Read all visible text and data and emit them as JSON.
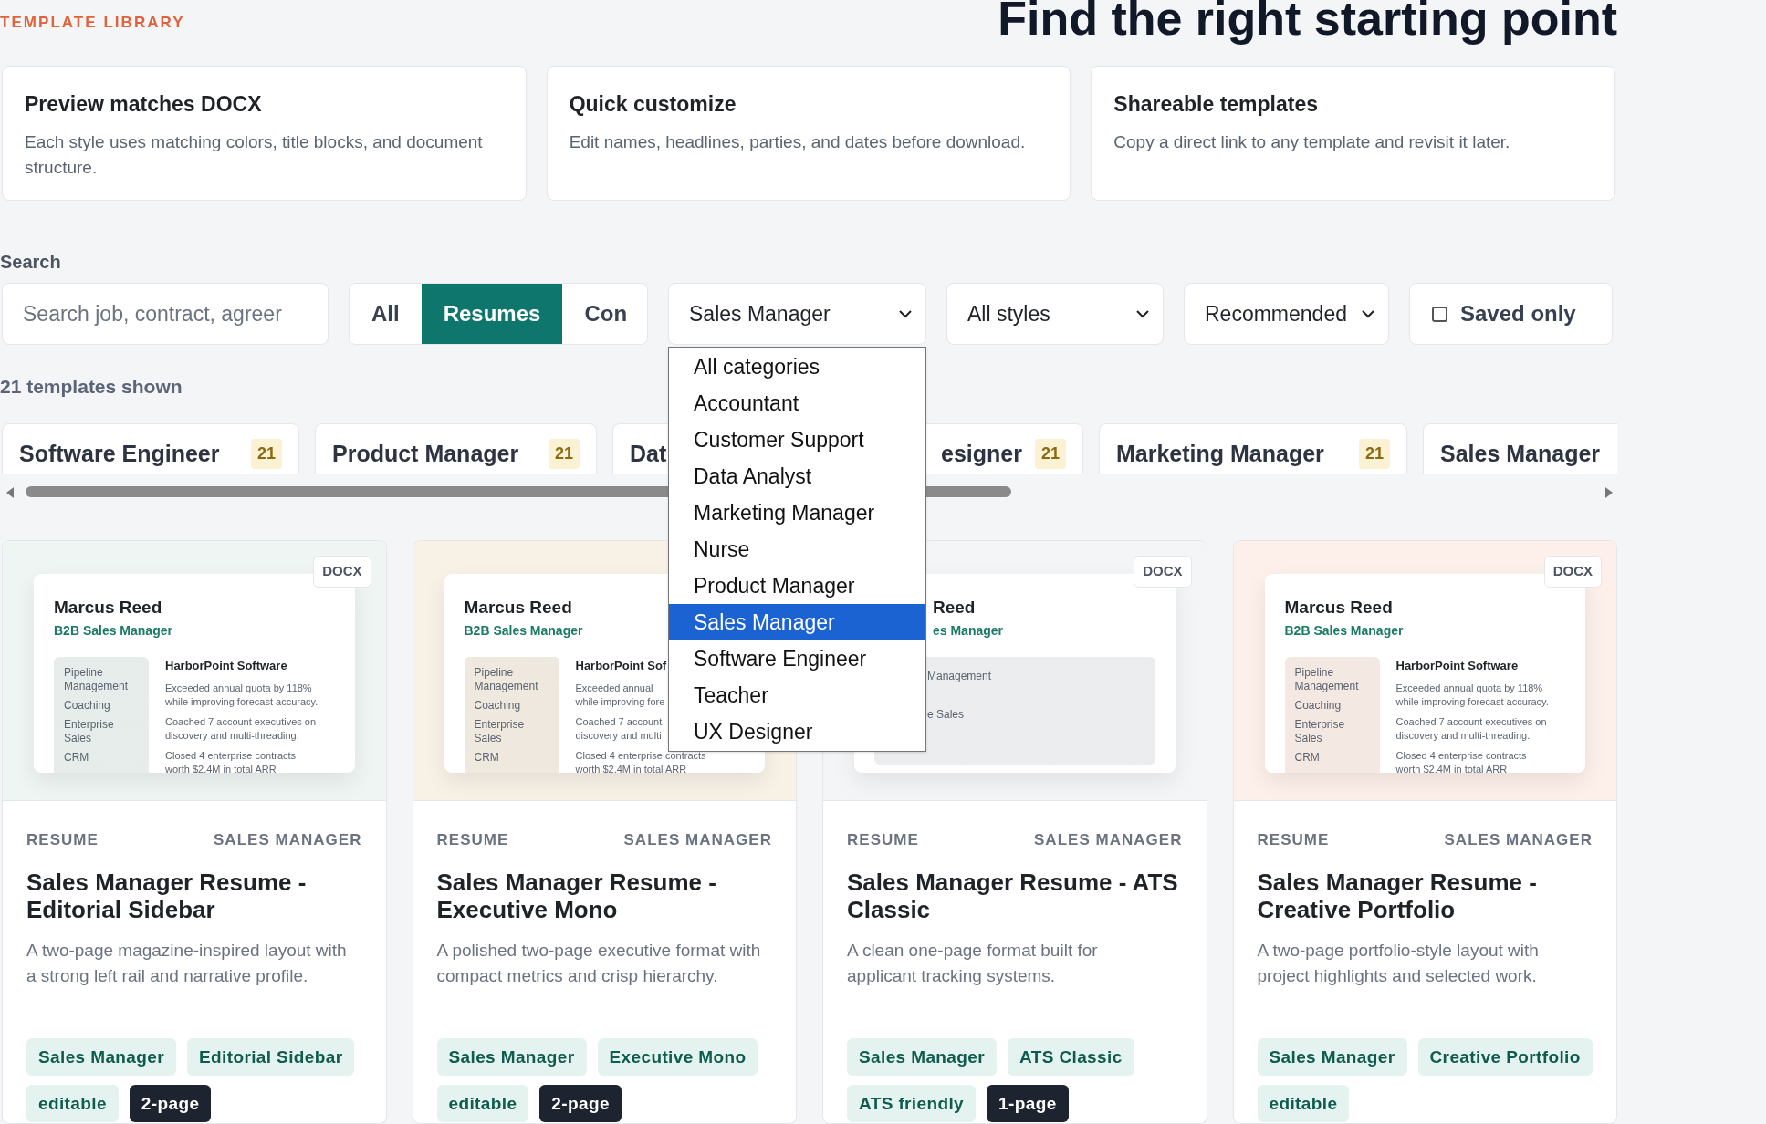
{
  "header": {
    "eyebrow": "TEMPLATE LIBRARY",
    "title": "Find the right starting point"
  },
  "features": [
    {
      "title": "Preview matches DOCX",
      "description": "Each style uses matching colors, title blocks, and document structure."
    },
    {
      "title": "Quick customize",
      "description": "Edit names, headlines, parties, and dates before download."
    },
    {
      "title": "Shareable templates",
      "description": "Copy a direct link to any template and revisit it later."
    }
  ],
  "search": {
    "label": "Search",
    "placeholder": "Search job, contract, agreer"
  },
  "type_tabs": [
    {
      "label": "All",
      "selected": false
    },
    {
      "label": "Resumes",
      "selected": true
    },
    {
      "label": "Con",
      "selected": false
    }
  ],
  "filters": [
    {
      "kind": "select",
      "value": "Sales Manager",
      "options": [
        {
          "label": "All categories",
          "selected": false
        },
        {
          "label": "Accountant",
          "selected": false
        },
        {
          "label": "Customer Support",
          "selected": false
        },
        {
          "label": "Data Analyst",
          "selected": false
        },
        {
          "label": "Marketing Manager",
          "selected": false
        },
        {
          "label": "Nurse",
          "selected": false
        },
        {
          "label": "Product Manager",
          "selected": false
        },
        {
          "label": "Sales Manager",
          "selected": true
        },
        {
          "label": "Software Engineer",
          "selected": false
        },
        {
          "label": "Teacher",
          "selected": false
        },
        {
          "label": "UX Designer",
          "selected": false
        }
      ]
    },
    {
      "kind": "select",
      "value": "All styles"
    },
    {
      "kind": "select",
      "value": "Recommended"
    },
    {
      "kind": "checkbox",
      "label": "Saved only",
      "checked": false
    }
  ],
  "result_count": "21 templates shown",
  "category_chips": [
    {
      "label": "Software Engineer",
      "count": "21"
    },
    {
      "label": "Product Manager",
      "count": "21"
    },
    {
      "label": "Dat"
    },
    {
      "label": "esigner",
      "count": "21"
    },
    {
      "label": "Marketing Manager",
      "count": "21"
    },
    {
      "label": "Sales Manager"
    }
  ],
  "cards": [
    {
      "color": "#eef5f3",
      "format": "DOCX",
      "preview": {
        "kind": "sidebar",
        "name": "Marcus Reed",
        "role": "B2B Sales Manager",
        "company": "HarborPoint Software",
        "skills": [
          "Pipeline\nManagement",
          "Coaching",
          "Enterprise\nSales",
          "CRM"
        ],
        "bullets": [
          "Exceeded annual quota by 118%\nwhile improving forecast accuracy.",
          "Coached 7 account executives on\ndiscovery and multi-threading.",
          "Closed 4 enterprise contracts\nworth $2.4M in total ARR"
        ]
      },
      "type": "RESUME",
      "category": "SALES MANAGER",
      "title": "Sales Manager Resume - Editorial Sidebar",
      "description": "A two-page magazine-inspired layout with a strong left rail and narrative profile.",
      "tags": [
        {
          "label": "Sales Manager",
          "kind": "soft"
        },
        {
          "label": "Editorial Sidebar",
          "kind": "soft"
        },
        {
          "label": "editable",
          "kind": "soft"
        },
        {
          "label": "2-page",
          "kind": "dark"
        }
      ]
    },
    {
      "color": "#f7f1e6",
      "preview": {
        "kind": "sidebar",
        "name": "Marcus Reed",
        "role": "B2B Sales Manager",
        "company": "HarborPoint Sof",
        "skills": [
          "Pipeline\nManagement",
          "Coaching",
          "Enterprise\nSales",
          "CRM"
        ],
        "bullets": [
          "Exceeded annual\nwhile improving fore",
          "Coached 7 account\ndiscovery and multi",
          "Closed 4 enterprise contracts\nworth $2.4M in total ARR"
        ]
      },
      "type": "RESUME",
      "category": "SALES MANAGER",
      "title": "Sales Manager Resume - Executive Mono",
      "description": "A polished two-page executive format with compact metrics and crisp hierarchy.",
      "tags": [
        {
          "label": "Sales Manager",
          "kind": "soft"
        },
        {
          "label": "Executive Mono",
          "kind": "soft"
        },
        {
          "label": "editable",
          "kind": "soft"
        },
        {
          "label": "2-page",
          "kind": "dark"
        }
      ]
    },
    {
      "color": "#f3f5f7",
      "format": "DOCX",
      "preview": {
        "kind": "ats",
        "name": "Reed",
        "role": "es Manager",
        "skills": [
          "Management",
          "e Sales"
        ]
      },
      "type": "RESUME",
      "category": "SALES MANAGER",
      "title": "Sales Manager Resume - ATS Classic",
      "description": "A clean one-page format built for applicant tracking systems.",
      "tags": [
        {
          "label": "Sales Manager",
          "kind": "soft"
        },
        {
          "label": "ATS Classic",
          "kind": "soft"
        },
        {
          "label": "ATS friendly",
          "kind": "soft"
        },
        {
          "label": "1-page",
          "kind": "dark"
        }
      ]
    },
    {
      "color": "#fdf0ea",
      "format": "DOCX",
      "preview": {
        "kind": "sidebar",
        "name": "Marcus Reed",
        "role": "B2B Sales Manager",
        "company": "HarborPoint Software",
        "skills": [
          "Pipeline\nManagement",
          "Coaching",
          "Enterprise\nSales",
          "CRM"
        ],
        "bullets": [
          "Exceeded annual quota by 118%\nwhile improving forecast accuracy.",
          "Coached 7 account executives on\ndiscovery and multi-threading.",
          "Closed 4 enterprise contracts\nworth $2.4M in total ARR"
        ]
      },
      "type": "RESUME",
      "category": "SALES MANAGER",
      "title": "Sales Manager Resume - Creative Portfolio",
      "description": "A two-page portfolio-style layout with project highlights and selected work.",
      "tags": [
        {
          "label": "Sales Manager",
          "kind": "soft"
        },
        {
          "label": "Creative Portfolio",
          "kind": "soft"
        },
        {
          "label": "editable",
          "kind": "soft"
        }
      ]
    }
  ]
}
